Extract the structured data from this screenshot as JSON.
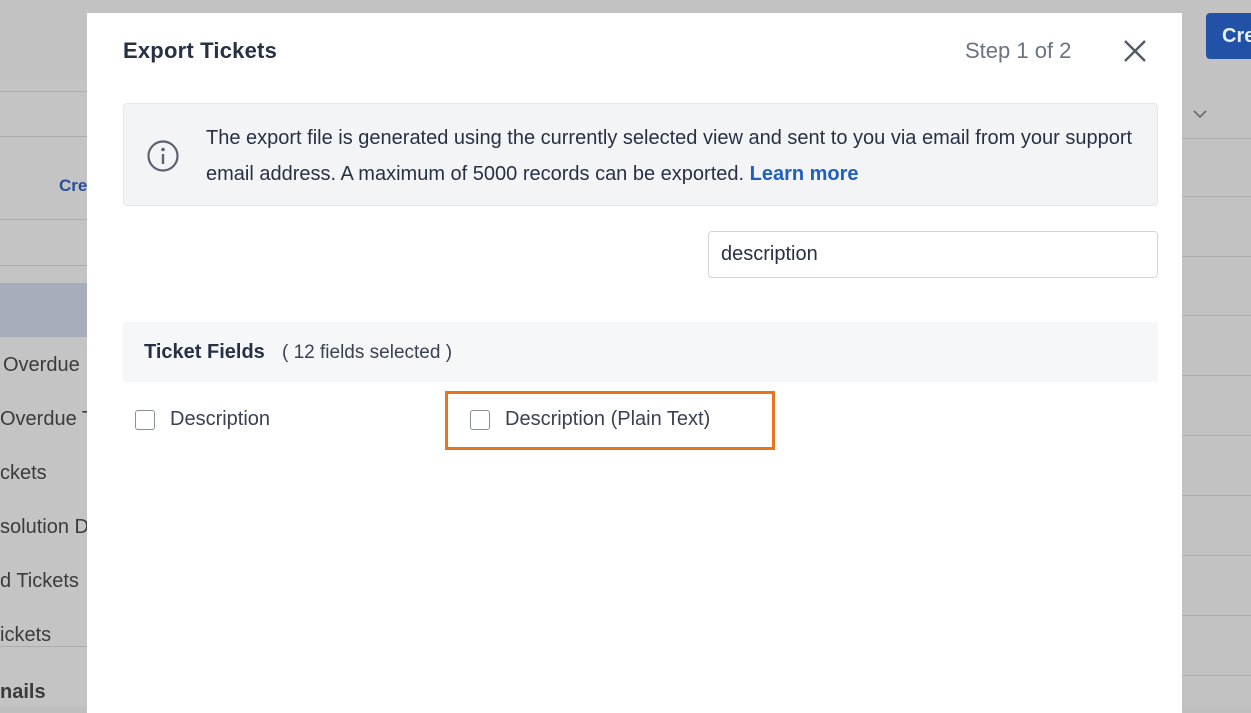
{
  "background": {
    "create_button_label": "Cre",
    "sidebar_link": "Cre",
    "sidebar_items": [
      "Overdue",
      "Overdue T",
      "ckets",
      "solution D",
      "d Tickets",
      "ickets",
      "nails"
    ]
  },
  "modal": {
    "title": "Export Tickets",
    "step": "Step 1 of 2",
    "info": {
      "text": "The export file is generated using the currently selected view and sent to you via email from your support email address. A maximum of 5000 records can be exported.",
      "link": "Learn more"
    },
    "search": {
      "value": "description"
    },
    "fields_section": {
      "title": "Ticket Fields",
      "count_text": "( 12 fields selected )",
      "fields": [
        {
          "label": "Description",
          "checked": false
        },
        {
          "label": "Description (Plain Text)",
          "checked": false
        }
      ]
    }
  },
  "colors": {
    "highlight": "#e8741e",
    "link": "#1e5fc0",
    "primary": "#2252a8"
  }
}
